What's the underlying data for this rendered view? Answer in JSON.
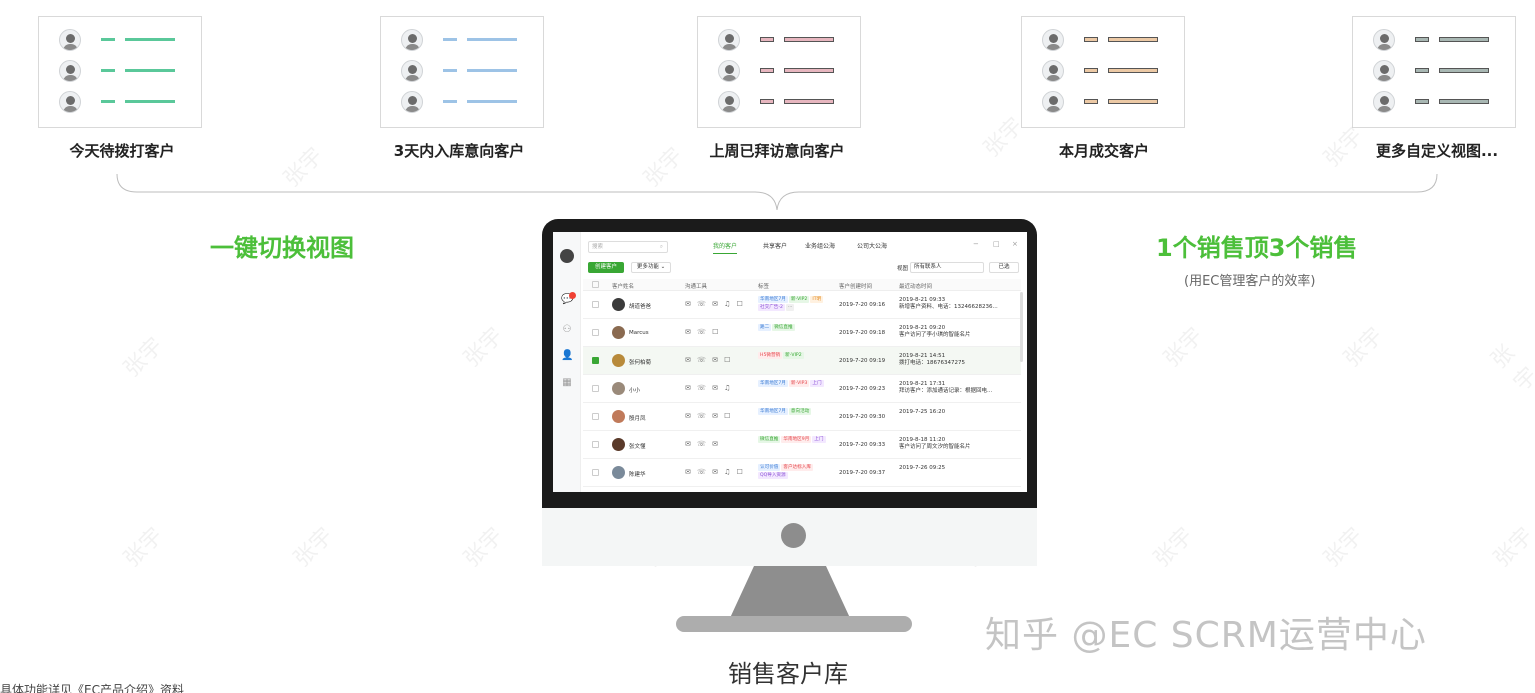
{
  "views": [
    {
      "caption": "今天待拨打客户",
      "short_color": "#5ac89a",
      "long_color": "#5ac89a",
      "style": "solid"
    },
    {
      "caption": "3天内入库意向客户",
      "short_color": "#9dc3e6",
      "long_color": "#9dc3e6",
      "style": "solid"
    },
    {
      "caption": "上周已拜访意向客户",
      "short_color": "#e7b6bf",
      "long_color": "#e7b6bf",
      "style": "outline"
    },
    {
      "caption": "本月成交客户",
      "short_color": "#ecc9a5",
      "long_color": "#ecc9a5",
      "style": "outline"
    },
    {
      "caption": "更多自定义视图...",
      "short_color": "#a8b7b3",
      "long_color": "#a8b7b3",
      "style": "outline"
    }
  ],
  "slogans": {
    "left": "一键切换视图",
    "right": "1个销售顶3个销售",
    "right_sub": "(用EC管理客户的效率)"
  },
  "monitor_title": "销售客户库",
  "watermark_text": "张宇",
  "app": {
    "search_placeholder": "搜索",
    "search_icon": "search-icon",
    "tabs": [
      "我的客户",
      "共享客户",
      "业务组公海",
      "公司大公海"
    ],
    "active_tab": 0,
    "window_controls": [
      "−",
      "□",
      "×"
    ],
    "new_button": "创建客户",
    "more_button": "更多功能",
    "filter_label": "视图",
    "filter_value": "所有联系人",
    "filter_button": "已选",
    "columns": [
      "客户姓名",
      "沟通工具",
      "标签",
      "客户创建时间",
      "最近动态时间"
    ],
    "rows": [
      {
        "name": "胡道爸爸",
        "tools": "✉ ☏ ✉ ♫ ☐",
        "tags": [
          {
            "t": "华南地区7月",
            "c": "blue"
          },
          {
            "t": "新-VIP2",
            "c": "green"
          },
          {
            "t": "IT明",
            "c": "orange"
          },
          {
            "t": "社交广告-2",
            "c": "purple"
          },
          {
            "t": "···",
            "c": "gray"
          }
        ],
        "created": "2019-7-20 09:16",
        "recent1": "2019-8-21 09:33",
        "recent2": "新增客户资料、电话：13246628236...",
        "selected": false
      },
      {
        "name": "Marcus",
        "tools": "✉ ☏ ☐",
        "tags": [
          {
            "t": "路二",
            "c": "blue"
          },
          {
            "t": "微信直推",
            "c": "green"
          }
        ],
        "created": "2019-7-20 09:18",
        "recent1": "2019-8-21 09:20",
        "recent2": "客户访问了李小琪的智能名片",
        "selected": false
      },
      {
        "name": "张何柏菊",
        "tools": "✉ ☏ ✉ ☐",
        "tags": [
          {
            "t": "H5微营销",
            "c": "red"
          },
          {
            "t": "新-VIP2",
            "c": "green"
          }
        ],
        "created": "2019-7-20 09:19",
        "recent1": "2019-8-21 14:51",
        "recent2": "拨打电话：18676347275",
        "selected": true
      },
      {
        "name": "小小",
        "tools": "✉ ☏ ✉ ♫",
        "tags": [
          {
            "t": "华南地区7月",
            "c": "blue"
          },
          {
            "t": "新-VIP3",
            "c": "red"
          },
          {
            "t": "上门",
            "c": "purple"
          }
        ],
        "created": "2019-7-20 09:23",
        "recent1": "2019-8-21 17:31",
        "recent2": "拜访客户：添加通话记录：根据回电...",
        "selected": false
      },
      {
        "name": "殷月凤",
        "tools": "✉ ☏ ✉ ☐",
        "tags": [
          {
            "t": "华南地区7月",
            "c": "blue"
          },
          {
            "t": "意向活动",
            "c": "green"
          }
        ],
        "created": "2019-7-20 09:30",
        "recent1": "2019-7-25 16:20",
        "recent2": "",
        "selected": false
      },
      {
        "name": "张文懂",
        "tools": "✉ ☏ ✉",
        "tags": [
          {
            "t": "微信直推",
            "c": "green"
          },
          {
            "t": "华南地区9月",
            "c": "red"
          },
          {
            "t": "上门",
            "c": "purple"
          }
        ],
        "created": "2019-7-20 09:33",
        "recent1": "2019-8-18 11:20",
        "recent2": "客户访问了周文汐的智能名片",
        "selected": false
      },
      {
        "name": "陈建华",
        "tools": "✉ ☏ ✉ ♫ ☐",
        "tags": [
          {
            "t": "认可价值",
            "c": "blue"
          },
          {
            "t": "客户达标入库",
            "c": "red"
          },
          {
            "t": "QQ导入资源",
            "c": "purple"
          }
        ],
        "created": "2019-7-20 09:37",
        "recent1": "2019-7-26 09:25",
        "recent2": "",
        "selected": false
      }
    ]
  },
  "bottom_left_text": "具体功能详见《EC产品介绍》资料",
  "zhihu_watermark": "知乎 @EC SCRM运营中心"
}
